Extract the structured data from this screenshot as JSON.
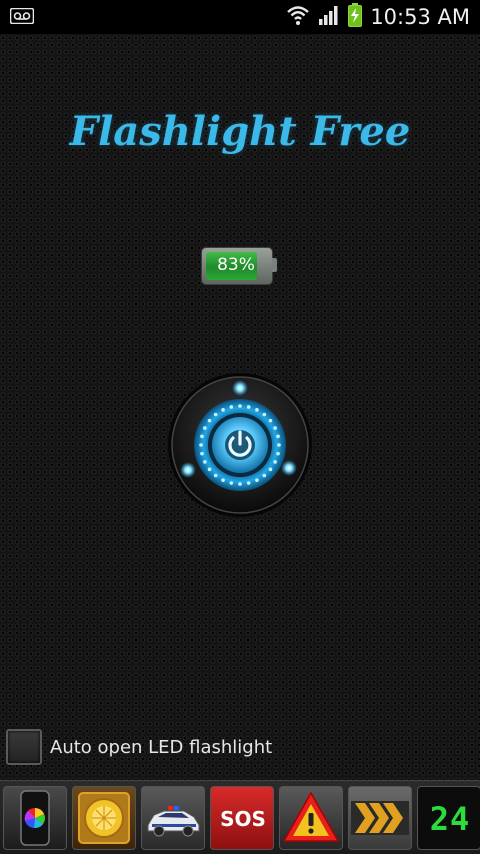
{
  "status_bar": {
    "time": "10:53 AM",
    "icons": [
      "voicemail-icon",
      "wifi-icon",
      "signal-icon",
      "battery-charging-icon"
    ]
  },
  "app": {
    "title": "Flashlight Free",
    "title_color": "#3bb9e8"
  },
  "battery": {
    "level_percent": 83,
    "label": "83%",
    "fill_color": "#2ea836"
  },
  "power_button": {
    "icon": "power-icon",
    "glow_color": "#27b5f0",
    "state": "on"
  },
  "auto_open": {
    "label": "Auto open LED flashlight",
    "checked": false
  },
  "bottom_tiles": [
    {
      "name": "color-screen",
      "icon": "phone-color-wheel-icon"
    },
    {
      "name": "emergency-lamp",
      "icon": "lamp-icon"
    },
    {
      "name": "police-light",
      "icon": "police-car-icon"
    },
    {
      "name": "sos",
      "label": "SOS",
      "icon": "sos-icon"
    },
    {
      "name": "warning",
      "icon": "warning-triangle-icon"
    },
    {
      "name": "strobe",
      "icon": "chevrons-icon"
    },
    {
      "name": "digital-clock",
      "label": "24",
      "icon": "digital-clock-icon"
    }
  ]
}
